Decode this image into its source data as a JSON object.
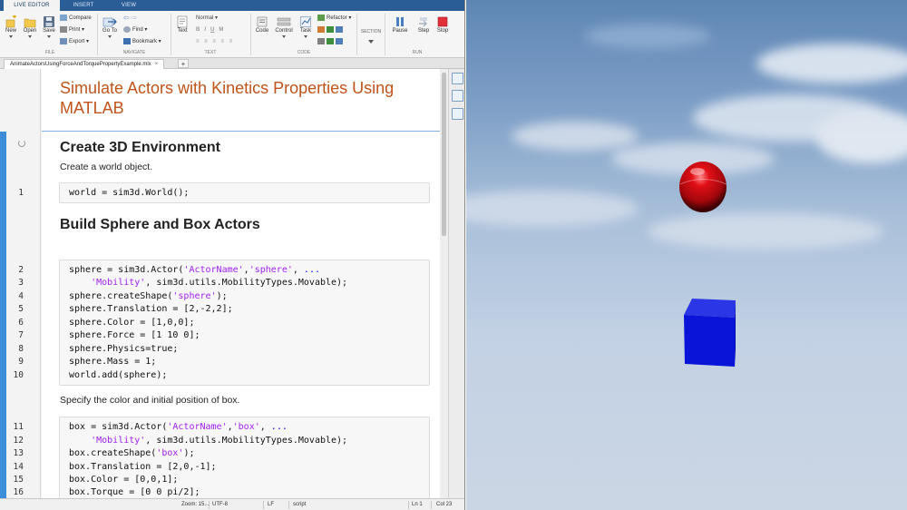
{
  "ribbon": {
    "tabs": [
      "LIVE EDITOR",
      "INSERT",
      "VIEW"
    ],
    "file": {
      "new": "New",
      "open": "Open",
      "save": "Save",
      "compare": "Compare",
      "print": "Print",
      "export": "Export",
      "section": "FILE"
    },
    "navigate": {
      "goto": "Go To",
      "find": "Find",
      "bookmark": "Bookmark",
      "section": "NAVIGATE"
    },
    "text": {
      "text": "Text",
      "style": "Normal",
      "bold": "B",
      "italic": "I",
      "underline": "U",
      "mono": "M",
      "section": "TEXT"
    },
    "code": {
      "code": "Code",
      "control": "Control",
      "task": "Task",
      "refactor": "Refactor",
      "section": "CODE"
    },
    "section_group": {
      "label": "SECTION"
    },
    "run": {
      "pause": "Pause",
      "step": "Step",
      "stop": "Stop",
      "section": "RUN"
    }
  },
  "document": {
    "tab_name": "AnimateActorsUsingForceAndTorquePropertyExample.mlx",
    "close_symbol": "×",
    "new_tab_symbol": "+",
    "title": "Simulate Actors with Kinetics Properties Using MATLAB",
    "heading1": "Create 3D Environment",
    "text1": "Create a world object.",
    "heading2": "Build Sphere and Box Actors",
    "text2": "Specify the color and initial position of box.",
    "line_numbers": [
      "1",
      "2",
      "3",
      "4",
      "5",
      "6",
      "7",
      "8",
      "9",
      "10",
      "11",
      "12",
      "13",
      "14",
      "15",
      "16"
    ]
  },
  "statusbar": {
    "zoom": "Zoom: 15...",
    "encoding": "UTF-8",
    "eol": "LF",
    "mode": "script",
    "line": "Ln 1",
    "col": "Col 23"
  },
  "colors": {
    "title": "#c0541a",
    "string_literal": "#a020f0",
    "keyword": "#0000ff",
    "sphere": "#ff0000",
    "box": "#0000ff",
    "sky": "#7d9ec6"
  }
}
